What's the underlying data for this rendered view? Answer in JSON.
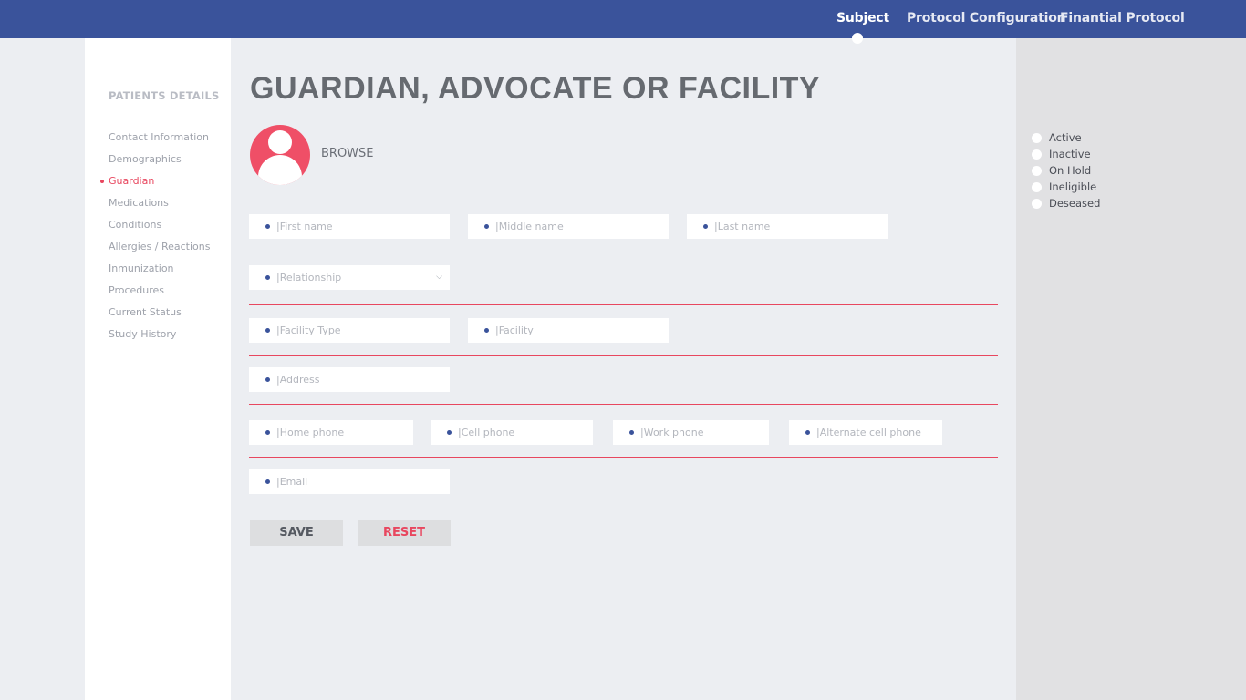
{
  "nav": {
    "items": [
      "Subject",
      "Protocol Configuration",
      "Finantial Protocol"
    ],
    "active": "Subject"
  },
  "sidebar": {
    "title": "PATIENTS DETAILS",
    "items": [
      "Contact Information",
      "Demographics",
      "Guardian",
      "Medications",
      "Conditions",
      "Allergies / Reactions",
      "Inmunization",
      "Procedures",
      "Current Status",
      "Study History"
    ],
    "active": "Guardian"
  },
  "main": {
    "title": "GUARDIAN, ADVOCATE OR FACILITY",
    "browse_label": "BROWSE",
    "fields": {
      "first_name": "|First name",
      "middle_name": "|Middle name",
      "last_name": "|Last name",
      "relationship": "|Relationship",
      "facility_type": "|Facility Type",
      "facility": "|Facility",
      "address": "|Address",
      "home_phone": "|Home phone",
      "cell_phone": "|Cell phone",
      "work_phone": "|Work phone",
      "alt_cell_phone": "|Alternate cell phone",
      "email": "|Email"
    },
    "buttons": {
      "save": "SAVE",
      "reset": "RESET"
    }
  },
  "status": {
    "options": [
      "Active",
      "Inactive",
      "On Hold",
      "Ineligible",
      "Deseased"
    ]
  },
  "colors": {
    "nav_bg": "#3a539b",
    "accent": "#e8475f",
    "page_bg": "#eceef2"
  }
}
